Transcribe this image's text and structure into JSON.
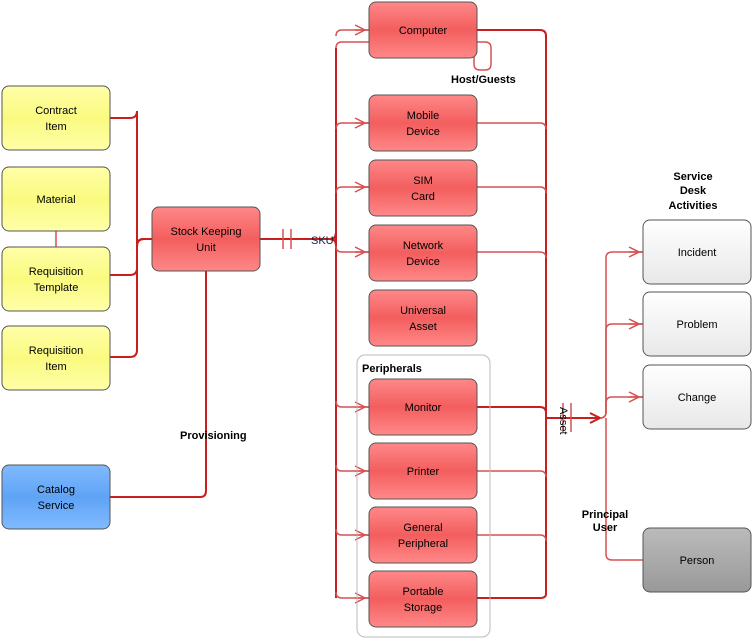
{
  "colors": {
    "red": "#f35e5e",
    "yellow": "#fcfc8c",
    "blue": "#5fa3f5",
    "white": "#f2f2f2",
    "gray": "#a8a8a8",
    "line": "#c81e1e"
  },
  "entities": {
    "contract_item": [
      "Contract",
      "Item"
    ],
    "material": [
      "Material"
    ],
    "requisition_template": [
      "Requisition",
      "Template"
    ],
    "requisition_item": [
      "Requisition",
      "Item"
    ],
    "catalog_service": [
      "Catalog",
      "Service"
    ],
    "sku": [
      "Stock Keeping",
      "Unit"
    ],
    "computer": [
      "Computer"
    ],
    "mobile_device": [
      "Mobile",
      "Device"
    ],
    "sim_card": [
      "SIM",
      "Card"
    ],
    "network_device": [
      "Network",
      "Device"
    ],
    "universal_asset": [
      "Universal",
      "Asset"
    ],
    "monitor": [
      "Monitor"
    ],
    "printer": [
      "Printer"
    ],
    "general_peripheral": [
      "General",
      "Peripheral"
    ],
    "portable_storage": [
      "Portable",
      "Storage"
    ],
    "incident": [
      "Incident"
    ],
    "problem": [
      "Problem"
    ],
    "change": [
      "Change"
    ],
    "person": [
      "Person"
    ]
  },
  "labels": {
    "host_guests": "Host/Guests",
    "provisioning": "Provisioning",
    "sku": "SKU",
    "asset": "Asset",
    "peripherals": "Peripherals",
    "service_desk": [
      "Service",
      "Desk",
      "Activities"
    ],
    "principal_user": [
      "Principal",
      "User"
    ]
  }
}
